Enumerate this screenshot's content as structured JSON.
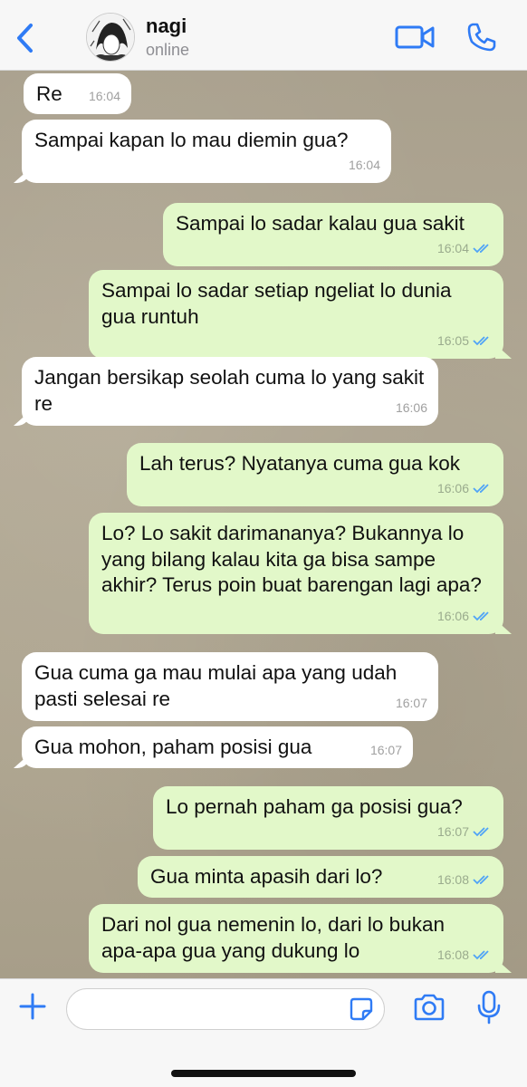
{
  "header": {
    "contact_name": "nagi",
    "status": "online",
    "back_icon": "chevron-left-icon",
    "video_icon": "video-camera-icon",
    "call_icon": "phone-icon",
    "accent_color": "#2f7bf5"
  },
  "messages": [
    {
      "dir": "in",
      "text": "Re",
      "time": "16:04"
    },
    {
      "dir": "in",
      "text": "Sampai kapan lo mau diemin gua?",
      "time": "16:04"
    },
    {
      "dir": "out",
      "text": "Sampai lo sadar kalau gua sakit",
      "time": "16:04",
      "read": true
    },
    {
      "dir": "out",
      "text": "Sampai lo sadar setiap ngeliat lo dunia gua runtuh",
      "time": "16:05",
      "read": true
    },
    {
      "dir": "in",
      "text": "Jangan bersikap seolah cuma lo yang sakit re",
      "time": "16:06"
    },
    {
      "dir": "out",
      "text": "Lah terus? Nyatanya cuma gua kok",
      "time": "16:06",
      "read": true
    },
    {
      "dir": "out",
      "text": "Lo? Lo sakit darimananya? Bukannya lo yang bilang kalau kita ga bisa sampe akhir? Terus poin buat barengan lagi apa?",
      "time": "16:06",
      "read": true
    },
    {
      "dir": "in",
      "text": "Gua cuma ga mau mulai apa yang udah pasti selesai re",
      "time": "16:07"
    },
    {
      "dir": "in",
      "text": "Gua mohon, paham posisi gua",
      "time": "16:07"
    },
    {
      "dir": "out",
      "text": "Lo pernah paham ga posisi gua?",
      "time": "16:07",
      "read": true
    },
    {
      "dir": "out",
      "text": "Gua minta apasih dari lo?",
      "time": "16:08",
      "read": true
    },
    {
      "dir": "out",
      "text": "Dari nol gua nemenin lo, dari lo bukan apa-apa gua yang dukung lo",
      "time": "16:08",
      "read": true
    }
  ],
  "composer": {
    "placeholder": "",
    "plus_icon": "plus-icon",
    "sticker_icon": "sticker-icon",
    "camera_icon": "camera-icon",
    "mic_icon": "microphone-icon"
  },
  "colors": {
    "incoming_bubble": "#ffffff",
    "outgoing_bubble": "#e2f8c9",
    "read_check": "#4fa3f7"
  }
}
